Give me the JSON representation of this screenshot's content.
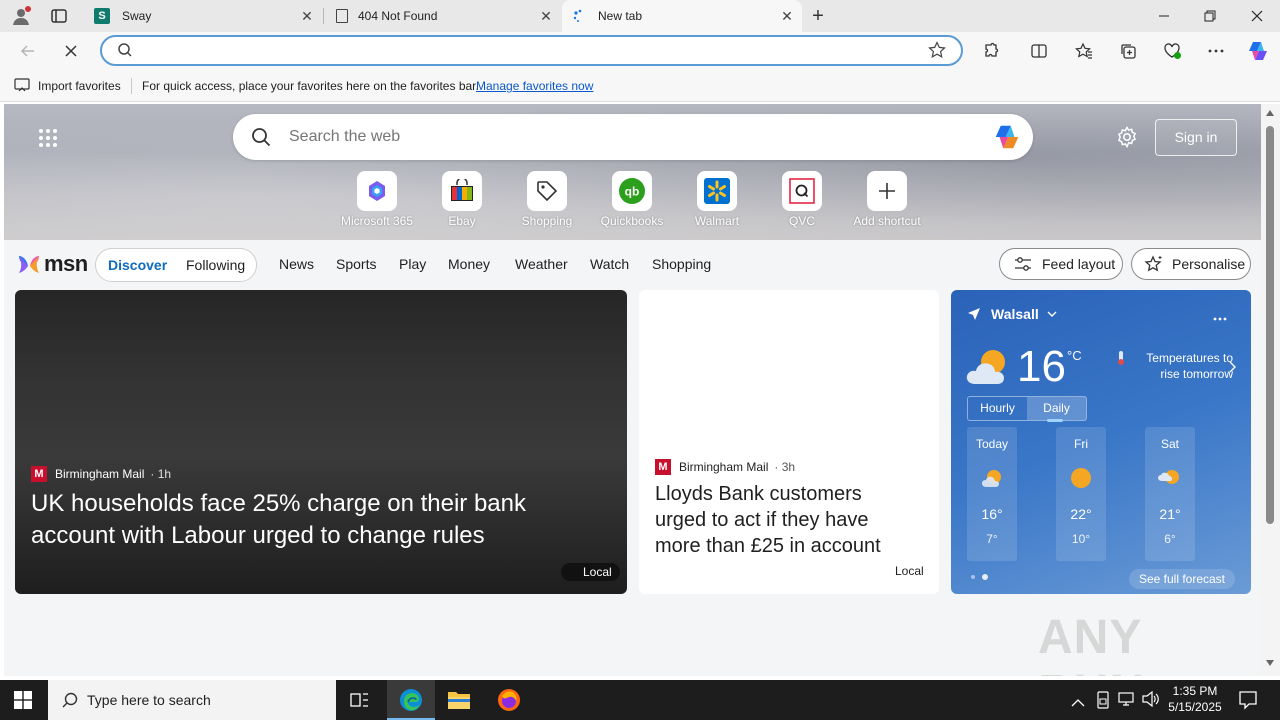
{
  "browser": {
    "tabs": [
      {
        "title": "Sway",
        "icon": "sway-icon",
        "active": false
      },
      {
        "title": "404 Not Found",
        "icon": "page-icon",
        "active": false
      },
      {
        "title": "New tab",
        "icon": "loading-icon",
        "active": true
      }
    ],
    "address": {
      "value": "",
      "placeholder": ""
    },
    "favorites_bar": {
      "import_label": "Import favorites",
      "message": "For quick access, place your favorites here on the favorites bar.",
      "manage_link": "Manage favorites now"
    }
  },
  "newtab": {
    "search_placeholder": "Search the web",
    "sign_in": "Sign in",
    "shortcuts": [
      {
        "label": "Microsoft 365",
        "icon": "m365-icon"
      },
      {
        "label": "Ebay",
        "icon": "ebay-icon"
      },
      {
        "label": "Shopping",
        "icon": "shopping-tag-icon"
      },
      {
        "label": "Quickbooks",
        "icon": "quickbooks-icon"
      },
      {
        "label": "Walmart",
        "icon": "walmart-icon"
      },
      {
        "label": "QVC",
        "icon": "qvc-icon"
      },
      {
        "label": "Add shortcut",
        "icon": "plus-icon"
      }
    ],
    "brand": "msn",
    "feed_tabs": [
      "Discover",
      "Following"
    ],
    "nav": [
      "News",
      "Sports",
      "Play",
      "Money",
      "Weather",
      "Watch",
      "Shopping"
    ],
    "feed_layout": "Feed layout",
    "personalise": "Personalise",
    "cards": {
      "main": {
        "source": "Birmingham Mail",
        "age": "· 1h",
        "headline": "UK households face 25% charge on their bank account with Labour urged to change rules",
        "tag": "Local"
      },
      "second": {
        "source": "Birmingham Mail",
        "age": "· 3h",
        "headline": "Lloyds Bank customers urged to act if they have more than £25 in account",
        "tag": "Local"
      }
    },
    "weather": {
      "location": "Walsall",
      "temp": "16",
      "unit": "°C",
      "alert": "Temperatures to rise tomorrow",
      "tabs": [
        "Hourly",
        "Daily"
      ],
      "days": [
        {
          "day": "Today",
          "hi": "16°",
          "lo": "7°",
          "icon": "partly-sunny-icon"
        },
        {
          "day": "Fri",
          "hi": "22°",
          "lo": "10°",
          "icon": "sunny-icon"
        },
        {
          "day": "Sat",
          "hi": "21°",
          "lo": "6°",
          "icon": "partly-sunny-icon"
        }
      ],
      "see_full": "See full forecast"
    }
  },
  "taskbar": {
    "search_placeholder": "Type here to search",
    "time": "1:35 PM",
    "date": "5/15/2025"
  },
  "watermark": "ANY RUN"
}
